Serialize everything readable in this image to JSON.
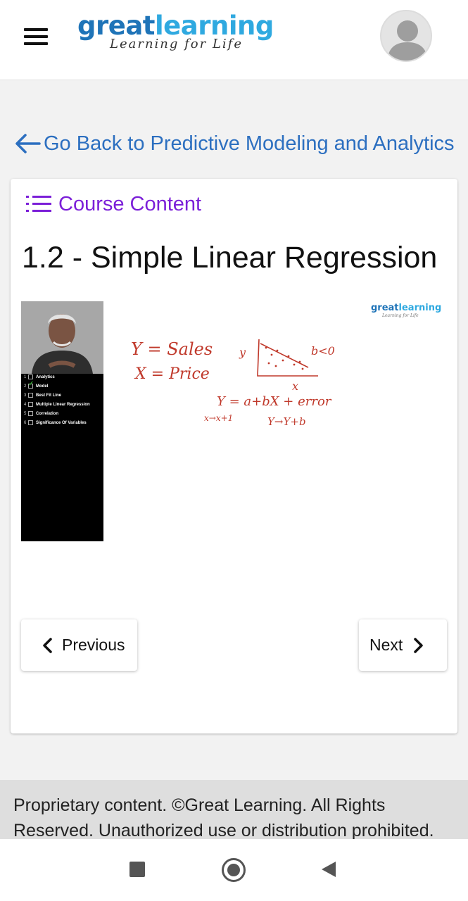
{
  "header": {
    "menu_icon": "hamburger-menu-icon",
    "logo": {
      "part1": "great",
      "part2": "learning",
      "tagline": "Learning for Life"
    },
    "avatar_icon": "user-avatar-icon"
  },
  "back_link": {
    "icon": "arrow-left-icon",
    "label": "Go Back to Predictive Modeling and Analytics"
  },
  "card": {
    "course_content": {
      "icon": "list-icon",
      "label": "Course Content"
    },
    "lesson_title": "1.2 - Simple Linear Regression",
    "video": {
      "logo": {
        "part1": "great",
        "part2": "learning",
        "tagline": "Learning for Life"
      },
      "toc": [
        {
          "num": "1",
          "label": "Analytics",
          "checked": false
        },
        {
          "num": "2",
          "label": "Model",
          "checked": true
        },
        {
          "num": "3",
          "label": "Best Fit Line",
          "checked": false
        },
        {
          "num": "4",
          "label": "Multiple Linear Regression",
          "checked": false
        },
        {
          "num": "5",
          "label": "Correlation",
          "checked": false
        },
        {
          "num": "6",
          "label": "Significance Of Variables",
          "checked": false
        }
      ],
      "whiteboard": {
        "line1": "Y = Sales",
        "line2": "X = Price",
        "axis_y": "y",
        "axis_x": "x",
        "slope_note": "b<0",
        "equation": "Y = a+bX + error",
        "x_shift": "x→x+1",
        "y_shift": "Y→Y+b"
      }
    },
    "prev_button": {
      "icon": "chevron-left-icon",
      "label": "Previous"
    },
    "next_button": {
      "icon": "chevron-right-icon",
      "label": "Next"
    }
  },
  "footer": {
    "text": "Proprietary content. ©Great Learning. All Rights Reserved. Unauthorized use or distribution prohibited."
  },
  "android_nav": {
    "recent_icon": "recent-apps-icon",
    "home_icon": "home-icon",
    "back_icon": "back-triangle-icon"
  },
  "colors": {
    "link_blue": "#2c6fc0",
    "accent_purple": "#7b1fd8",
    "logo_dark": "#1f74b8",
    "logo_light": "#2fa9e0",
    "marker_red": "#c0392b"
  }
}
